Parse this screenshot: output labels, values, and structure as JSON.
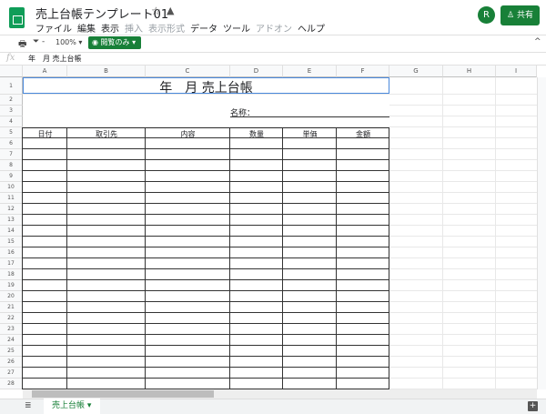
{
  "app": {
    "title": "売上台帳テンプレート01",
    "star_icon": "star-icon",
    "drive_icon": "drive-icon",
    "avatar": "R",
    "share": "共有",
    "brand_color": "#188038"
  },
  "menu": [
    {
      "label": "ファイル",
      "enabled": true
    },
    {
      "label": "編集",
      "enabled": true
    },
    {
      "label": "表示",
      "enabled": true
    },
    {
      "label": "挿入",
      "enabled": false
    },
    {
      "label": "表示形式",
      "enabled": false
    },
    {
      "label": "データ",
      "enabled": true
    },
    {
      "label": "ツール",
      "enabled": true
    },
    {
      "label": "アドオン",
      "enabled": false
    },
    {
      "label": "ヘルプ",
      "enabled": true
    }
  ],
  "toolbar": {
    "zoom": "100%",
    "view_only": "閲覧のみ"
  },
  "formula_bar": {
    "fx": "fx",
    "value": "年　月 売上台帳"
  },
  "columns": [
    "A",
    "B",
    "C",
    "D",
    "E",
    "F",
    "G",
    "H",
    "I"
  ],
  "rows": [
    1,
    2,
    3,
    4,
    5,
    6,
    7,
    8,
    9,
    10,
    11,
    12,
    13,
    14,
    15,
    16,
    17,
    18,
    19,
    20,
    21,
    22,
    23,
    24,
    25,
    26,
    27,
    28
  ],
  "sheet": {
    "title": "年　月 売上台帳",
    "name_label": "名称：",
    "headers": [
      "日付",
      "取引先",
      "内容",
      "数量",
      "単価",
      "金額"
    ]
  },
  "tabs": [
    {
      "label": "売上台帳",
      "active": true
    }
  ]
}
